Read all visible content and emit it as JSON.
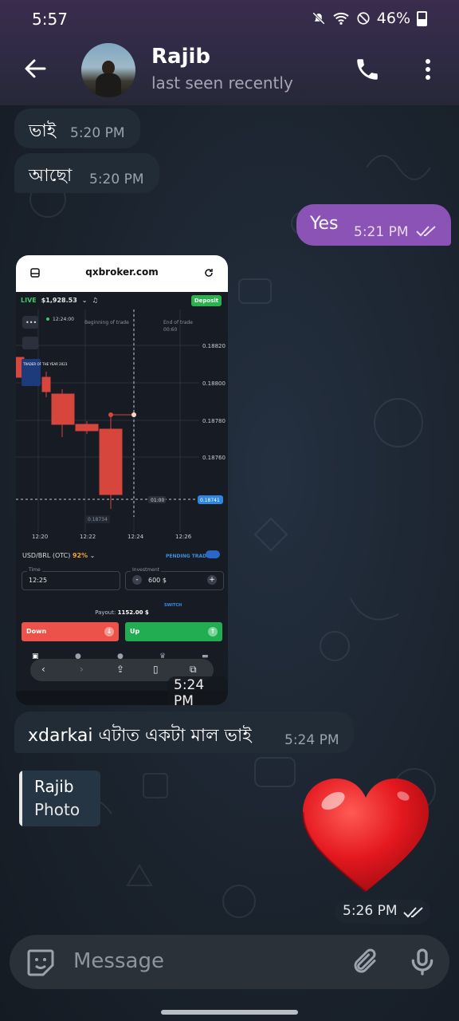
{
  "status_bar": {
    "time": "5:57",
    "battery": "46%"
  },
  "chat_header": {
    "name": "Rajib",
    "status": "last seen recently"
  },
  "messages": [
    {
      "text": "ভাই",
      "time": "5:20 PM"
    },
    {
      "text": "আছো",
      "time": "5:20 PM"
    },
    {
      "text": "Yes",
      "time": "5:21 PM"
    },
    {
      "text": "xdarkai এটাত একটা মাল ভাই",
      "time": "5:24 PM"
    }
  ],
  "photo_message": {
    "time": "5:24 PM",
    "screenshot": {
      "url": "qxbroker.com",
      "mode": "LIVE",
      "balance": "$1,928.53",
      "deposit": "Deposit",
      "chart_labels": {
        "beginning": "Beginning of trade",
        "end": "End of trade",
        "end_time": "00:60",
        "point_time": "12:24:00",
        "countdown": "01:00",
        "current_price": "0.18741",
        "low_label": "0.18734"
      },
      "y_ticks": [
        "0.18820",
        "0.18800",
        "0.18780",
        "0.18760"
      ],
      "x_ticks": [
        "12:20",
        "12:22",
        "12:24",
        "12:26"
      ],
      "promo": "TRADER OF THE YEAR 2023",
      "pair": "USD/BRL (OTC)",
      "pair_payout": "92%",
      "pending_trade": "PENDING TRADE",
      "time_label": "Time",
      "time_value": "12:25",
      "investment_label": "Investment",
      "investment_value": "600 $",
      "switch": "SWITCH",
      "payout_label": "Payout:",
      "payout_value": "1152.00 $",
      "down": "Down",
      "up": "Up"
    }
  },
  "reply_preview": {
    "name": "Rajib",
    "text": "Photo"
  },
  "heart_message": {
    "time": "5:26 PM"
  },
  "composer": {
    "placeholder": "Message"
  },
  "colors": {
    "outgoing_bubble": "#8c53b6",
    "incoming_bubble": "#222c37",
    "heart": "#e3171e"
  }
}
